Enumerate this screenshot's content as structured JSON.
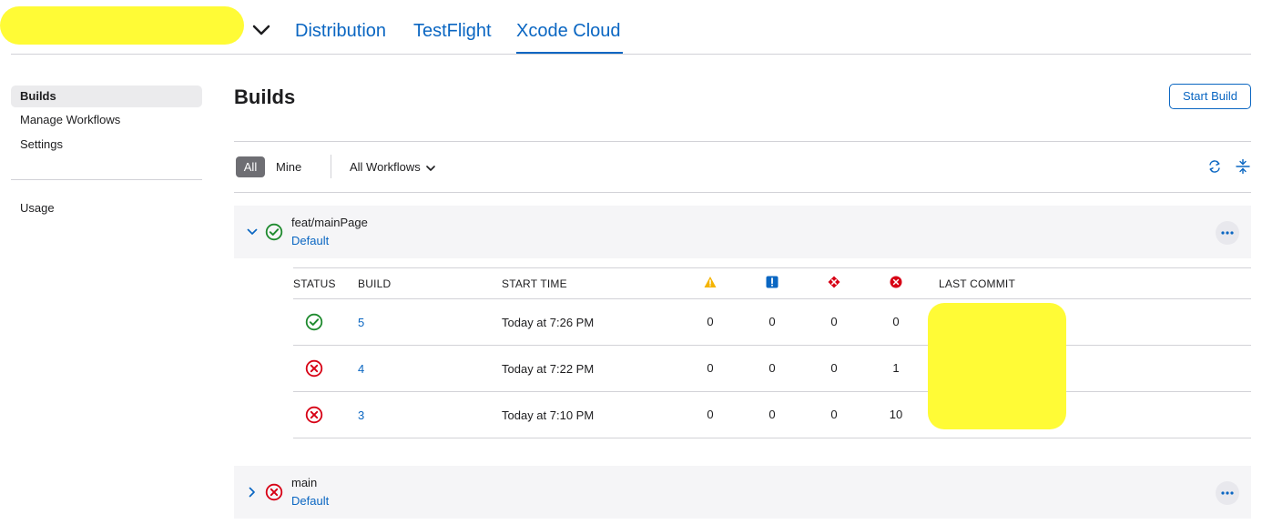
{
  "nav": {
    "tabs": [
      {
        "label": "Distribution"
      },
      {
        "label": "TestFlight"
      },
      {
        "label": "Xcode Cloud"
      }
    ]
  },
  "sidebar": {
    "items": [
      {
        "label": "Builds"
      },
      {
        "label": "Manage Workflows"
      },
      {
        "label": "Settings"
      },
      {
        "label": "Usage"
      }
    ]
  },
  "page": {
    "title": "Builds",
    "start_build_label": "Start Build"
  },
  "filters": {
    "all_label": "All",
    "mine_label": "Mine",
    "workflow_select": "All Workflows"
  },
  "table": {
    "headers": {
      "status": "STATUS",
      "build": "BUILD",
      "start_time": "START TIME",
      "last_commit": "LAST COMMIT"
    },
    "rows": [
      {
        "status": "success",
        "build": "5",
        "start_time": "Today at 7:26 PM",
        "warnings": "0",
        "analyzer": "0",
        "test_failures": "0",
        "errors": "0"
      },
      {
        "status": "failed",
        "build": "4",
        "start_time": "Today at 7:22 PM",
        "warnings": "0",
        "analyzer": "0",
        "test_failures": "0",
        "errors": "1"
      },
      {
        "status": "failed",
        "build": "3",
        "start_time": "Today at 7:10 PM",
        "warnings": "0",
        "analyzer": "0",
        "test_failures": "0",
        "errors": "10"
      }
    ]
  },
  "groups": [
    {
      "branch": "feat/mainPage",
      "workflow": "Default",
      "status": "success",
      "expanded": true
    },
    {
      "branch": "main",
      "workflow": "Default",
      "status": "failed",
      "expanded": false
    }
  ],
  "colors": {
    "accent": "#0a66c2",
    "success": "#1e8a2e",
    "error": "#d70015",
    "warning": "#f5b400",
    "redaction": "#fffb36"
  }
}
